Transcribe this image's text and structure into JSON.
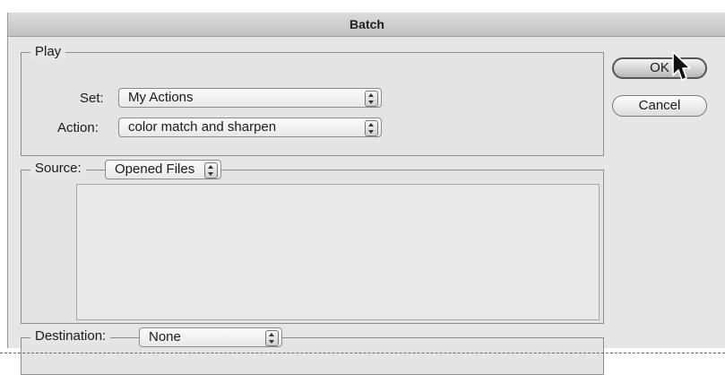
{
  "window": {
    "title": "Batch"
  },
  "play": {
    "legend": "Play",
    "set_label": "Set:",
    "set_value": "My Actions",
    "action_label": "Action:",
    "action_value": "color match and sharpen"
  },
  "source": {
    "label": "Source:",
    "value": "Opened Files"
  },
  "destination": {
    "label": "Destination:",
    "value": "None"
  },
  "buttons": {
    "ok": "OK",
    "cancel": "Cancel"
  },
  "icons": {
    "pointer": "arrow-cursor-icon",
    "stepper": "up-down-stepper-icon"
  }
}
